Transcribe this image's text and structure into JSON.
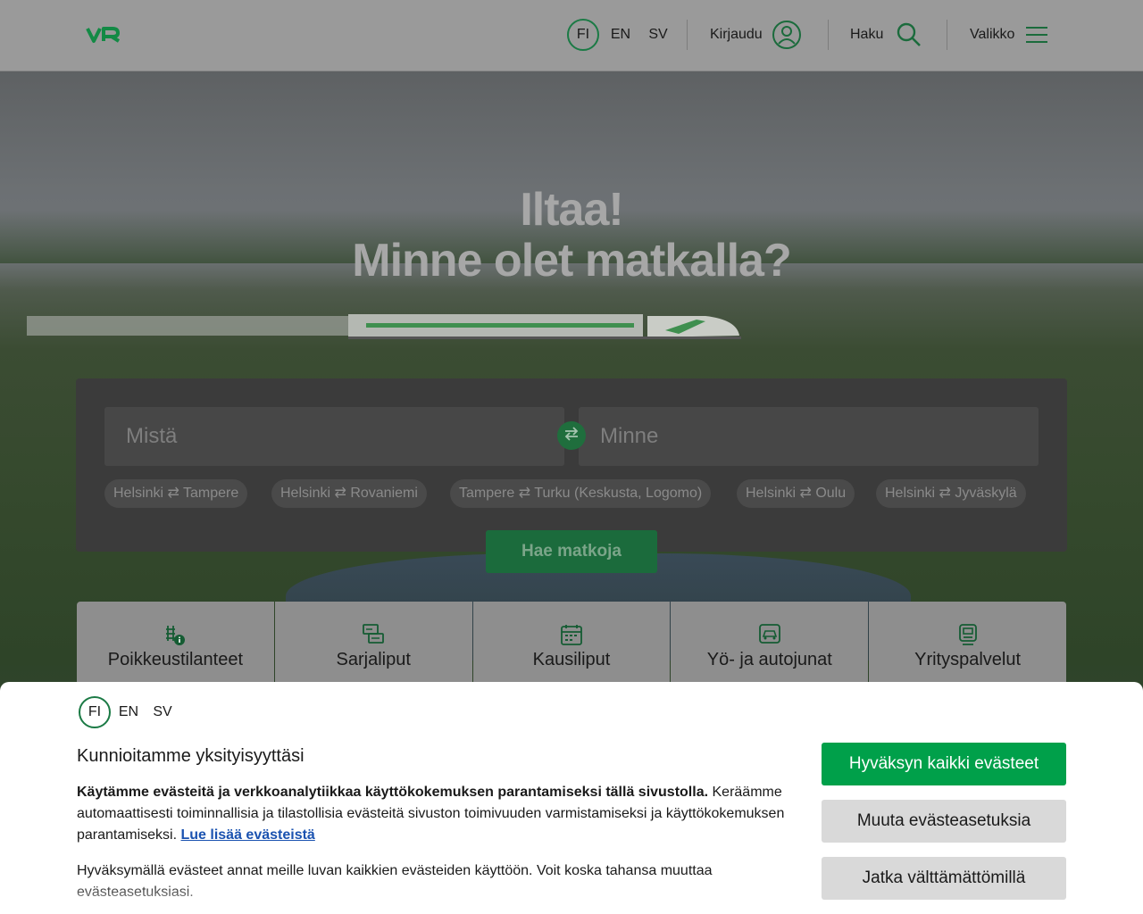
{
  "header": {
    "logo_text": "VR",
    "languages": [
      "FI",
      "EN",
      "SV"
    ],
    "active_language": "FI",
    "login_label": "Kirjaudu",
    "search_label": "Haku",
    "menu_label": "Valikko",
    "accent_color": "#1b7a45"
  },
  "hero": {
    "greeting": "Iltaa!",
    "question": "Minne olet matkalla?"
  },
  "search": {
    "from_placeholder": "Mistä",
    "to_placeholder": "Minne",
    "swap_icon": "swap-arrows-icon",
    "popular_routes": [
      {
        "from": "Helsinki",
        "to": "Tampere"
      },
      {
        "from": "Helsinki",
        "to": "Rovaniemi"
      },
      {
        "from": "Tampere",
        "to": "Turku (Keskusta, Logomo)"
      },
      {
        "from": "Helsinki",
        "to": "Oulu"
      },
      {
        "from": "Helsinki",
        "to": "Jyväskylä"
      }
    ],
    "route_separator": "⇄",
    "search_button": "Hae matkoja"
  },
  "tiles": [
    {
      "label": "Poikkeustilanteet",
      "icon": "disruption-info-icon"
    },
    {
      "label": "Sarjaliput",
      "icon": "series-ticket-icon"
    },
    {
      "label": "Kausiliput",
      "icon": "season-ticket-calendar-icon"
    },
    {
      "label": "Yö- ja autojunat",
      "icon": "car-train-icon"
    },
    {
      "label": "Yrityspalvelut",
      "icon": "business-train-icon"
    }
  ],
  "cookie": {
    "languages": [
      "FI",
      "EN",
      "SV"
    ],
    "active_language": "FI",
    "title": "Kunnioitamme yksityisyyttäsi",
    "body_bold": "Käytämme evästeitä ja verkkoanalytiikkaa käyttökokemuksen parantamiseksi tällä sivustolla.",
    "body_rest": " Keräämme automaattisesti toiminnallisia ja tilastollisia evästeitä sivuston toimivuuden varmistamiseksi ja käyttökokemuksen parantamiseksi. ",
    "read_more_link": "Lue lisää evästeistä",
    "body2": "Hyväksymällä evästeet annat meille luvan kaikkien evästeiden käyttöön. Voit koska tahansa muuttaa evästeasetuksiasi.",
    "accept_all": "Hyväksyn kaikki evästeet",
    "change_settings": "Muuta evästeasetuksia",
    "necessary_only": "Jatka välttämättömillä",
    "primary_color": "#00a04a"
  }
}
